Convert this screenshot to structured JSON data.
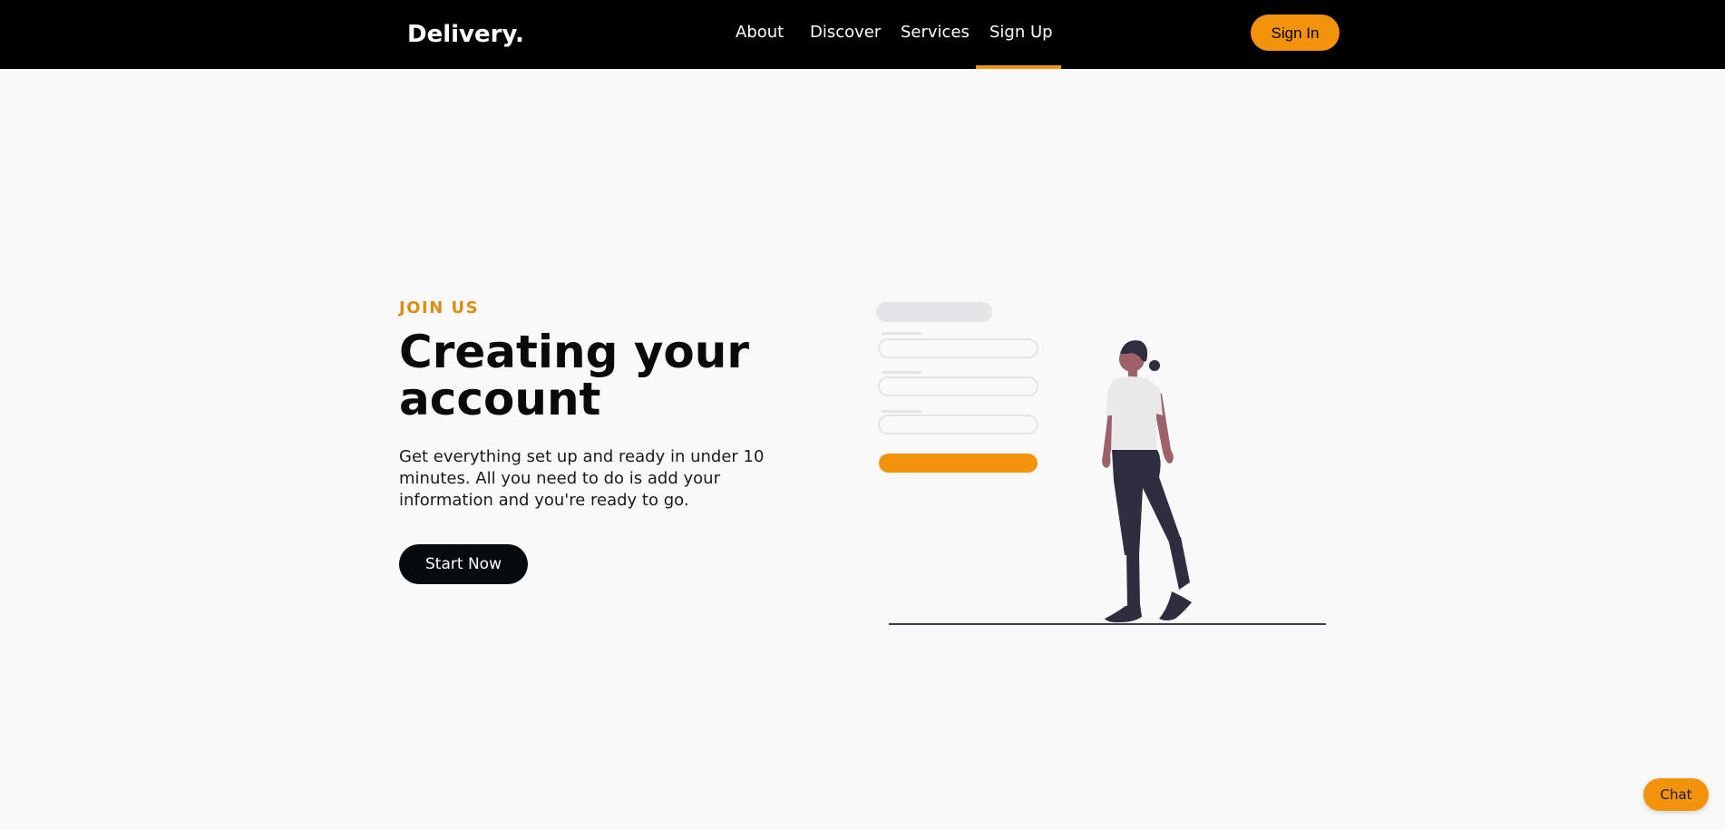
{
  "header": {
    "logo": "Delivery.",
    "nav": [
      {
        "label": "About"
      },
      {
        "label": "Discover"
      },
      {
        "label": "Services"
      },
      {
        "label": "Sign Up",
        "active": true
      }
    ],
    "signin_label": "Sign In"
  },
  "hero": {
    "eyebrow": "JOIN US",
    "title": "Creating your account",
    "description": "Get everything set up and ready in under 10 minutes. All you need to do is add your information and you're ready to go.",
    "cta_label": "Start Now"
  },
  "chat": {
    "label": "Chat"
  },
  "colors": {
    "accent": "#f2930b",
    "header_bg": "#000000",
    "page_bg": "#f9f9f9",
    "cta_bg": "#050a0c"
  },
  "icons": {
    "illustration": "signup-form-illustration"
  }
}
